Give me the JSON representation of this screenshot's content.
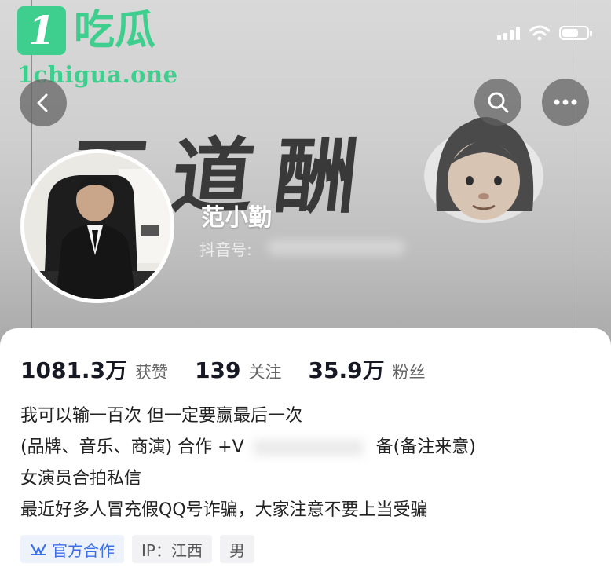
{
  "watermark": {
    "badge": "1",
    "title": "吃瓜",
    "url": "1chigua.one"
  },
  "header": {
    "calligraphy_text": "天道酬",
    "colors": {
      "banner": "#c8c8c8",
      "button_bg": "#5f5f5f"
    },
    "icons": [
      "chevron-left-icon",
      "search-icon",
      "more-icon",
      "signal-icon",
      "wifi-icon",
      "battery-icon"
    ]
  },
  "profile": {
    "name": "范小勤",
    "id_label": "抖音号:"
  },
  "stats": [
    {
      "value": "1081.3万",
      "label": "获赞"
    },
    {
      "value": "139",
      "label": "关注"
    },
    {
      "value": "35.9万",
      "label": "粉丝"
    }
  ],
  "bio": {
    "line1": "我可以输一百次 但一定要赢最后一次",
    "line2_prefix": "(品牌、音乐、商演) 合作 +V",
    "line2_suffix": "备(备注来意)",
    "line3": "女演员合拍私信",
    "line4": "最近好多人冒充假QQ号诈骗，大家注意不要上当受骗"
  },
  "tags": {
    "official": "官方合作",
    "ip": "IP：江西",
    "gender": "男",
    "accent_color": "#3b6fe8"
  }
}
